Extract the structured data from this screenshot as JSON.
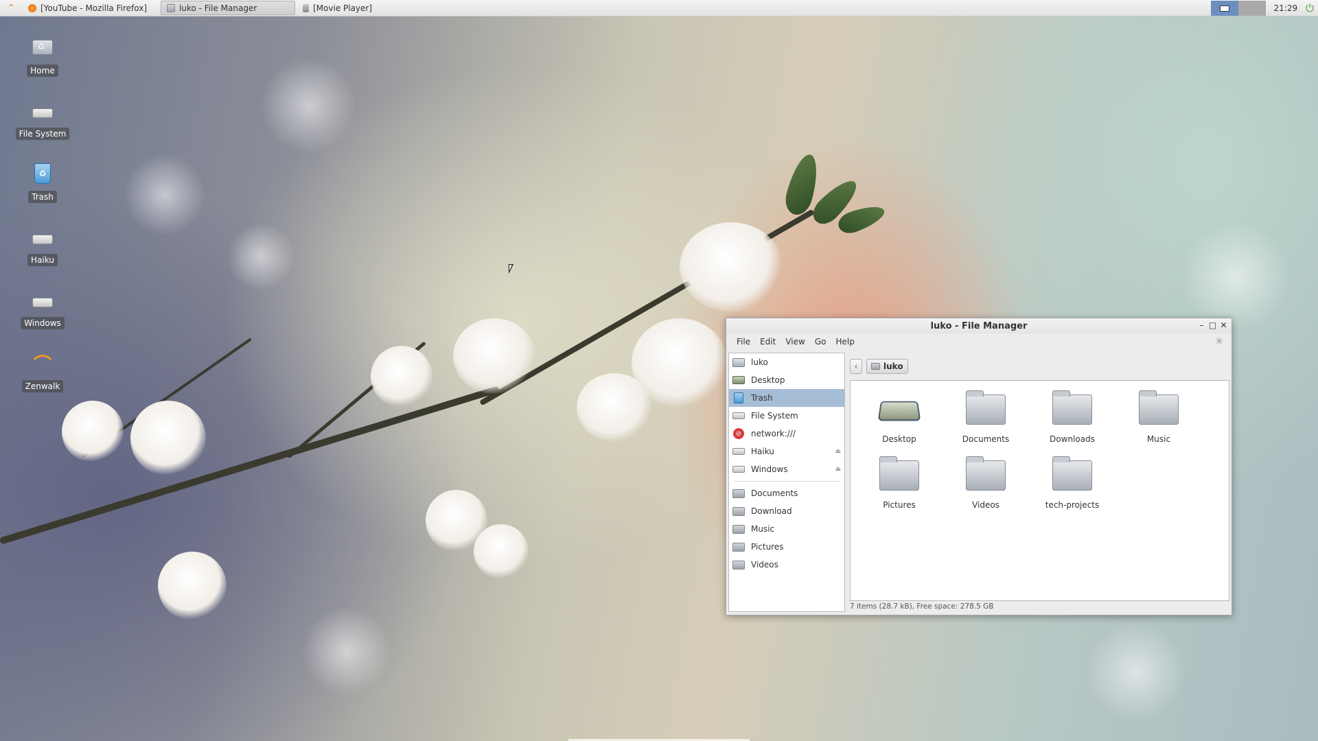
{
  "taskbar": {
    "tasks": [
      {
        "label": "[YouTube - Mozilla Firefox]",
        "icon": "firefox-icon"
      },
      {
        "label": "luko - File Manager",
        "icon": "folder-icon"
      },
      {
        "label": "[Movie Player]",
        "icon": "video-icon"
      }
    ],
    "clock": "21:29"
  },
  "desktop": {
    "icons": [
      {
        "label": "Home",
        "icon": "home-icon"
      },
      {
        "label": "File System",
        "icon": "drive-icon"
      },
      {
        "label": "Trash",
        "icon": "trash-icon"
      },
      {
        "label": "Haiku",
        "icon": "drive-icon"
      },
      {
        "label": "Windows",
        "icon": "drive-icon"
      },
      {
        "label": "Zenwalk",
        "icon": "zenwalk-logo-icon"
      }
    ]
  },
  "window": {
    "title": "luko - File Manager",
    "menu": [
      "File",
      "Edit",
      "View",
      "Go",
      "Help"
    ],
    "sidebar": {
      "devices": [
        {
          "label": "luko",
          "icon": "home-icon"
        },
        {
          "label": "Desktop",
          "icon": "desktop-icon"
        },
        {
          "label": "Trash",
          "icon": "trash-icon"
        },
        {
          "label": "File System",
          "icon": "drive-icon"
        },
        {
          "label": "network:///",
          "icon": "network-icon"
        },
        {
          "label": "Haiku",
          "icon": "drive-icon"
        },
        {
          "label": "Windows",
          "icon": "drive-icon"
        }
      ],
      "bookmarks": [
        {
          "label": "Documents",
          "icon": "folder-icon"
        },
        {
          "label": "Download",
          "icon": "folder-icon"
        },
        {
          "label": "Music",
          "icon": "folder-icon"
        },
        {
          "label": "Pictures",
          "icon": "folder-icon"
        },
        {
          "label": "Videos",
          "icon": "folder-icon"
        }
      ],
      "selected": "Trash"
    },
    "path": {
      "crumb": "luko"
    },
    "items": [
      {
        "label": "Desktop",
        "icon": "desktop-icon"
      },
      {
        "label": "Documents",
        "icon": "folder-icon"
      },
      {
        "label": "Downloads",
        "icon": "folder-icon"
      },
      {
        "label": "Music",
        "icon": "folder-icon"
      },
      {
        "label": "Pictures",
        "icon": "folder-icon"
      },
      {
        "label": "Videos",
        "icon": "folder-icon"
      },
      {
        "label": "tech-projects",
        "icon": "folder-icon"
      }
    ],
    "status": "7 items (28.7 kB), Free space: 278.5 GB"
  },
  "colors": {
    "selection": "#a6bdd6",
    "workspace_active": "#6d8fbf",
    "accent_power": "#4aa532"
  }
}
